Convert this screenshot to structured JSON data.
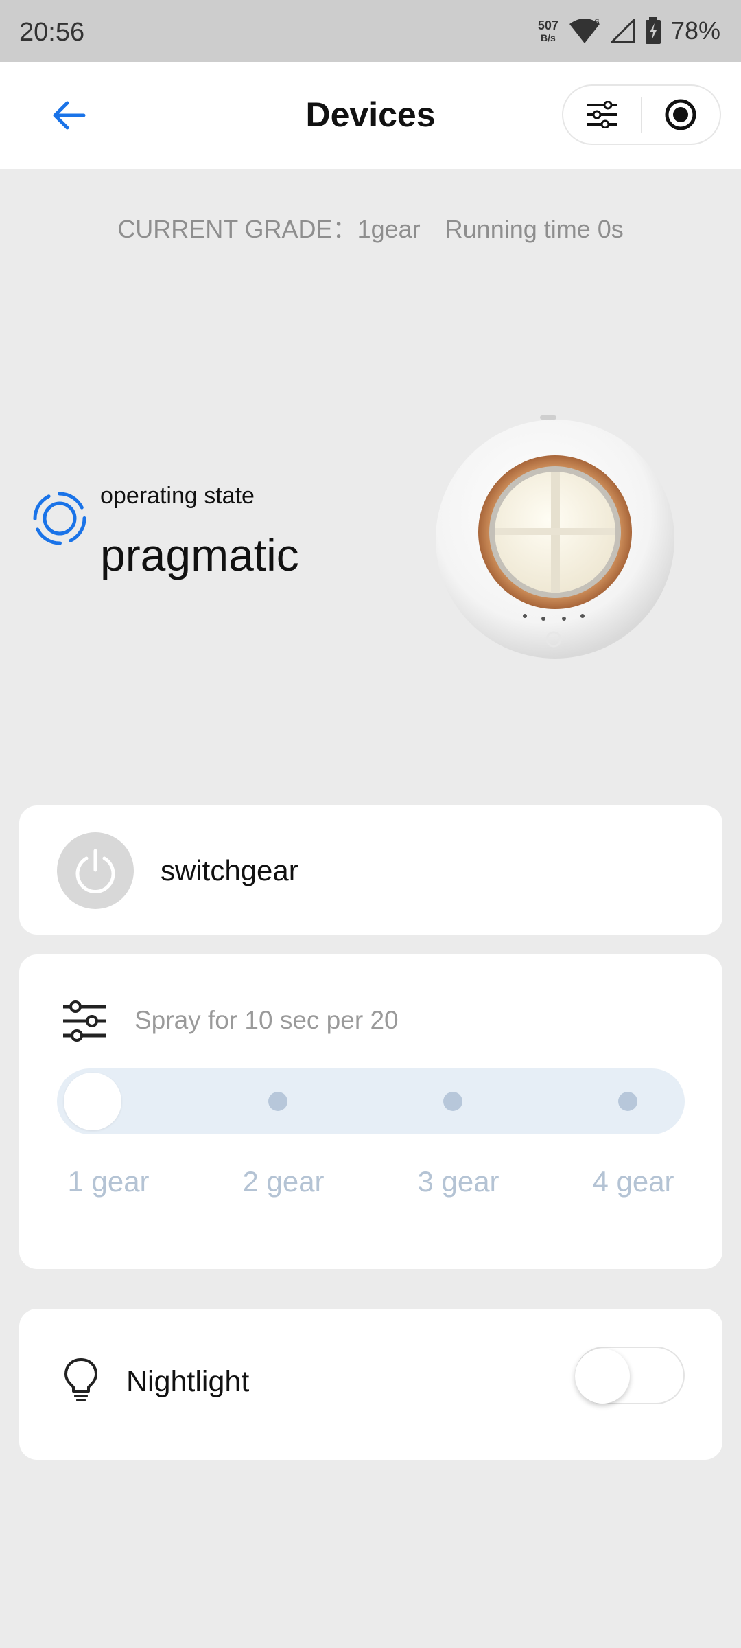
{
  "status_bar": {
    "time": "20:56",
    "net_speed_value": "507",
    "net_speed_unit": "B/s",
    "wifi_badge": "6",
    "battery": "78%"
  },
  "header": {
    "title": "Devices",
    "back_icon": "arrow-left-icon",
    "menu_icon": "sliders-icon",
    "record_icon": "record-icon"
  },
  "info": {
    "grade": "CURRENT GRADE：1gear",
    "running_time": "Running time 0s"
  },
  "operating_state": {
    "label": "operating state",
    "value": "pragmatic"
  },
  "switchgear": {
    "label": "switchgear"
  },
  "gear": {
    "description": "Spray for 10 sec per 20",
    "options": [
      "1 gear",
      "2 gear",
      "3 gear",
      "4 gear"
    ],
    "selected_index": 0
  },
  "nightlight": {
    "label": "Nightlight",
    "on": false
  },
  "colors": {
    "accent": "#1a73e8",
    "track": "#e6eef6",
    "gear_label": "#b4c3d4"
  }
}
